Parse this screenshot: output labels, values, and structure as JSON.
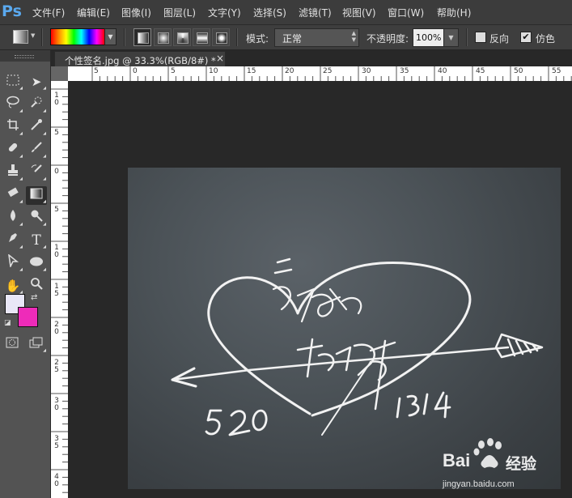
{
  "app": {
    "logo": "Ps"
  },
  "menu": [
    "文件(F)",
    "编辑(E)",
    "图像(I)",
    "图层(L)",
    "文字(Y)",
    "选择(S)",
    "滤镜(T)",
    "视图(V)",
    "窗口(W)",
    "帮助(H)"
  ],
  "options": {
    "mode_label": "模式:",
    "mode_value": "正常",
    "opacity_label": "不透明度:",
    "opacity_value": "100%",
    "reverse_label": "反向",
    "reverse_checked": false,
    "dither_label": "仿色",
    "dither_checked": true
  },
  "document": {
    "tab_title": "个性签名.jpg @ 33.3%(RGB/8#) *",
    "close": "×"
  },
  "ruler": {
    "h_labels": [
      "5",
      "0",
      "5",
      "10",
      "15",
      "20",
      "25",
      "30",
      "35",
      "40",
      "45",
      "50",
      "55"
    ],
    "v_labels": [
      "1 0",
      "5",
      "0",
      "5",
      "1 0",
      "1 5",
      "2 0",
      "2 5",
      "3 0",
      "3 5",
      "4 0"
    ]
  },
  "tools": {
    "foreground_color": "#e9e7f7",
    "background_color": "#ee2bb9"
  },
  "watermark": {
    "brand": "Bai",
    "brand2": "经验",
    "url": "jingyan.baidu.com"
  }
}
